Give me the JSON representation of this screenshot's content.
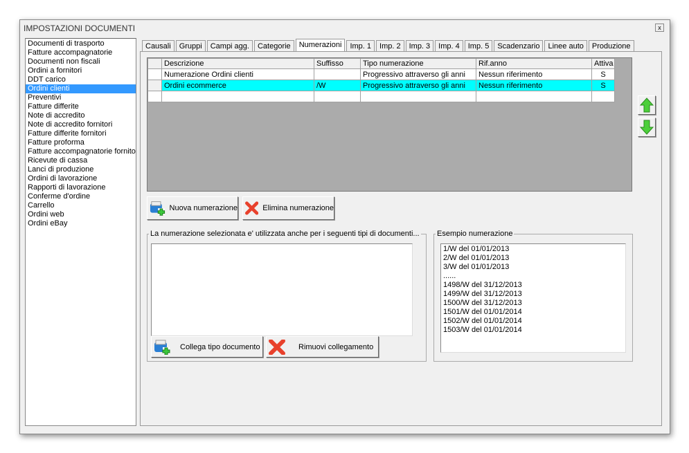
{
  "window": {
    "title": "IMPOSTAZIONI DOCUMENTI",
    "close_label": "x"
  },
  "doc_types": [
    "Documenti di trasporto",
    "Fatture accompagnatorie",
    "Documenti non fiscali",
    "Ordini a fornitori",
    "DDT carico",
    "Ordini clienti",
    "Preventivi",
    "Fatture differite",
    "Note di accredito",
    "Note di accredito fornitori",
    "Fatture differite fornitori",
    "Fatture proforma",
    "Fatture accompagnatorie fornitori",
    "Ricevute di cassa",
    "Lanci di produzione",
    "Ordini di lavorazione",
    "Rapporti di lavorazione",
    "Conferme d'ordine",
    "Carrello",
    "Ordini web",
    "Ordini eBay"
  ],
  "selected_doc_type": "Ordini clienti",
  "tabs": [
    "Causali",
    "Gruppi",
    "Campi agg.",
    "Categorie",
    "Numerazioni",
    "Imp. 1",
    "Imp. 2",
    "Imp. 3",
    "Imp. 4",
    "Imp. 5",
    "Scadenzario",
    "Linee auto",
    "Produzione"
  ],
  "active_tab": "Numerazioni",
  "grid": {
    "columns": [
      "Descrizione",
      "Suffisso",
      "Tipo numerazione",
      "Rif.anno",
      "Attiva"
    ],
    "rows": [
      [
        "Numerazione Ordini clienti",
        "",
        "Progressivo attraverso gli anni",
        "Nessun riferimento",
        "S"
      ],
      [
        "Ordini ecommerce",
        "/W",
        "Progressivo attraverso gli anni",
        "Nessun riferimento",
        "S"
      ],
      [
        "",
        "",
        "",
        "",
        ""
      ]
    ],
    "selected_row": 1,
    "highlight_color": "#00ffff"
  },
  "buttons": {
    "nuova": "Nuova numerazione",
    "elimina": "Elimina numerazione",
    "collega": "Collega tipo documento",
    "rimuovi": "Rimuovi collegamento",
    "up": "arrow-up-icon",
    "down": "arrow-down-icon"
  },
  "linked_group": {
    "legend": "La numerazione selezionata e' utilizzata anche per i seguenti tipi di documenti...",
    "items": []
  },
  "example_group": {
    "legend": "Esempio numerazione",
    "lines": [
      "1/W del 01/01/2013",
      "2/W del 01/01/2013",
      "3/W del 01/01/2013",
      "......",
      "1498/W del 31/12/2013",
      "1499/W del 31/12/2013",
      "1500/W del 31/12/2013",
      "1501/W del 01/01/2014",
      "1502/W del 01/01/2014",
      "1503/W del 01/01/2014"
    ]
  }
}
